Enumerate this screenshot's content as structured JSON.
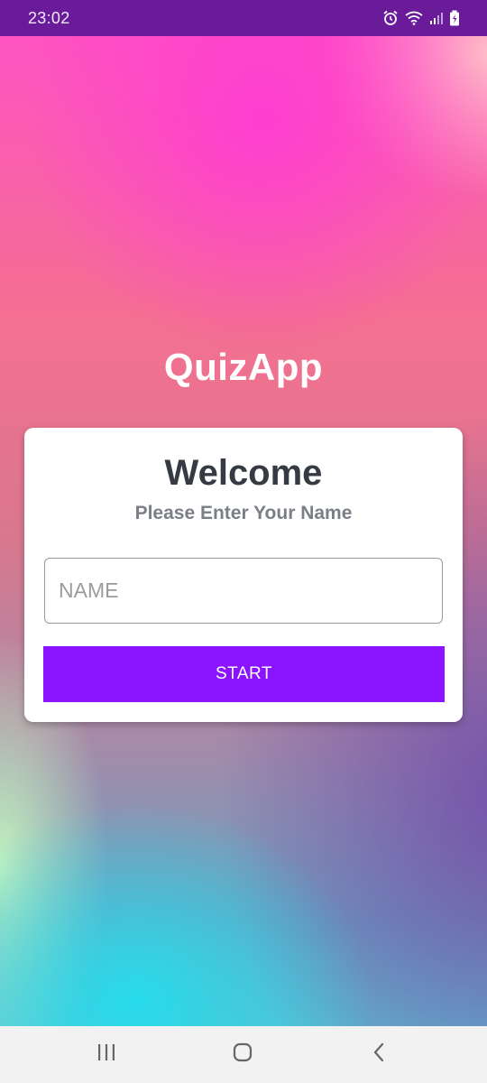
{
  "status_bar": {
    "time": "23:02",
    "icons": [
      "alarm-icon",
      "wifi-icon",
      "signal-icon",
      "battery-charging-icon"
    ]
  },
  "app": {
    "title": "QuizApp"
  },
  "card": {
    "heading": "Welcome",
    "subtitle": "Please Enter Your Name",
    "name_input": {
      "placeholder": "NAME",
      "value": ""
    },
    "start_button_label": "START"
  },
  "nav_bar": {
    "buttons": [
      "recents-icon",
      "home-icon",
      "back-icon"
    ]
  },
  "colors": {
    "status_bar": "#6a1b9a",
    "start_button": "#8b13ff",
    "heading_text": "#363a43",
    "subtitle_text": "#7a7e86"
  }
}
